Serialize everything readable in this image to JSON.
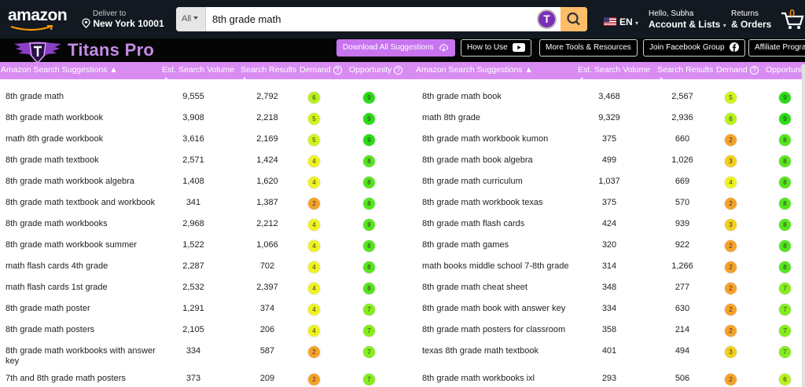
{
  "amazon": {
    "logo": "amazon",
    "deliver_line1": "Deliver to",
    "deliver_line2": "New York 10001",
    "search_category": "All",
    "search_value": "8th grade math",
    "titans_badge": "T",
    "lang": "EN",
    "account_line1": "Hello, Subha",
    "account_line2": "Account & Lists",
    "orders_line1": "Returns",
    "orders_line2": "& Orders",
    "cart_count": "0"
  },
  "titans": {
    "name": "Titans Pro",
    "download_label": "Download All Suggestions",
    "howto_label": "How to Use",
    "more_label": "More Tools & Resources",
    "facebook_label": "Join Facebook Group",
    "affiliate_label": "Affiliate Progra"
  },
  "table": {
    "headers": {
      "keyword": "Amazon Search Suggestions",
      "volume": "Est. Search Volume",
      "results": "Search Results",
      "demand": "Demand",
      "opportunity": "Opportunity",
      "sort_arrow": "▲",
      "help": "?"
    },
    "left": [
      {
        "kw": "8th grade math",
        "vol": "9,555",
        "res": "2,792",
        "demand": 6,
        "opp": 9
      },
      {
        "kw": "8th grade math workbook",
        "vol": "3,908",
        "res": "2,218",
        "demand": 5,
        "opp": 9
      },
      {
        "kw": "math 8th grade workbook",
        "vol": "3,616",
        "res": "2,169",
        "demand": 5,
        "opp": 9
      },
      {
        "kw": "8th grade math textbook",
        "vol": "2,571",
        "res": "1,424",
        "demand": 4,
        "opp": 8
      },
      {
        "kw": "8th grade math workbook algebra",
        "vol": "1,408",
        "res": "1,620",
        "demand": 4,
        "opp": 8
      },
      {
        "kw": "8th grade math textbook and workbook",
        "vol": "341",
        "res": "1,387",
        "demand": 2,
        "opp": 8
      },
      {
        "kw": "8th grade math workbooks",
        "vol": "2,968",
        "res": "2,212",
        "demand": 4,
        "opp": 8
      },
      {
        "kw": "8th grade math workbook summer",
        "vol": "1,522",
        "res": "1,066",
        "demand": 4,
        "opp": 8
      },
      {
        "kw": "math flash cards 4th grade",
        "vol": "2,287",
        "res": "702",
        "demand": 4,
        "opp": 8
      },
      {
        "kw": "math flash cards 1st grade",
        "vol": "2,532",
        "res": "2,397",
        "demand": 4,
        "opp": 8
      },
      {
        "kw": "8th grade math poster",
        "vol": "1,291",
        "res": "374",
        "demand": 4,
        "opp": 7
      },
      {
        "kw": "8th grade math posters",
        "vol": "2,105",
        "res": "206",
        "demand": 4,
        "opp": 7
      },
      {
        "kw": "8th grade math workbooks with answer key",
        "vol": "334",
        "res": "587",
        "demand": 2,
        "opp": 7
      },
      {
        "kw": "7th and 8th grade math posters",
        "vol": "373",
        "res": "209",
        "demand": 2,
        "opp": 7
      }
    ],
    "right": [
      {
        "kw": "8th grade math book",
        "vol": "3,468",
        "res": "2,567",
        "demand": 5,
        "opp": 9
      },
      {
        "kw": "math 8th grade",
        "vol": "9,329",
        "res": "2,936",
        "demand": 6,
        "opp": 9
      },
      {
        "kw": "8th grade math workbook kumon",
        "vol": "375",
        "res": "660",
        "demand": 2,
        "opp": 8
      },
      {
        "kw": "8th grade math book algebra",
        "vol": "499",
        "res": "1,026",
        "demand": 3,
        "opp": 8
      },
      {
        "kw": "8th grade math curriculum",
        "vol": "1,037",
        "res": "669",
        "demand": 4,
        "opp": 8
      },
      {
        "kw": "8th grade math workbook texas",
        "vol": "375",
        "res": "570",
        "demand": 2,
        "opp": 8
      },
      {
        "kw": "8th grade math flash cards",
        "vol": "424",
        "res": "939",
        "demand": 3,
        "opp": 8
      },
      {
        "kw": "8th grade math games",
        "vol": "320",
        "res": "922",
        "demand": 2,
        "opp": 8
      },
      {
        "kw": "math books middle school 7-8th grade",
        "vol": "314",
        "res": "1,266",
        "demand": 2,
        "opp": 8
      },
      {
        "kw": "8th grade math cheat sheet",
        "vol": "348",
        "res": "277",
        "demand": 2,
        "opp": 7
      },
      {
        "kw": "8th grade math book with answer key",
        "vol": "334",
        "res": "630",
        "demand": 2,
        "opp": 7
      },
      {
        "kw": "8th grade math posters for classroom",
        "vol": "358",
        "res": "214",
        "demand": 2,
        "opp": 7
      },
      {
        "kw": "texas 8th grade math textbook",
        "vol": "401",
        "res": "494",
        "demand": 3,
        "opp": 7
      },
      {
        "kw": "8th grade math workbooks ixl",
        "vol": "293",
        "res": "506",
        "demand": 2,
        "opp": 6
      }
    ]
  },
  "score_colors": {
    "2": "#f5a12a",
    "3": "#f2cf1d",
    "4": "#eef21f",
    "5": "#d2f21e",
    "6": "#b7f01e",
    "7": "#86ec1e",
    "8": "#56e51d",
    "9": "#2bdc15"
  }
}
